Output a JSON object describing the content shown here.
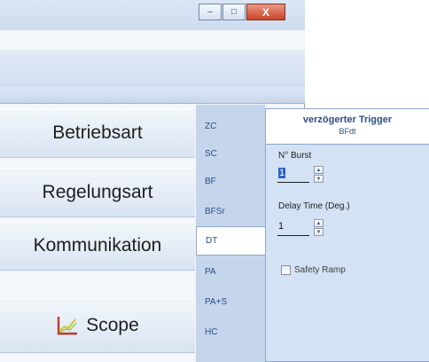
{
  "window": {
    "minimize_symbol": "–",
    "maximize_symbol": "□",
    "close_symbol": "X"
  },
  "nav": {
    "items": [
      {
        "label": "Betriebsart"
      },
      {
        "label": "Regelungsart"
      },
      {
        "label": "Kommunikation"
      },
      {
        "label": "Scope",
        "icon": "scope-chart-icon"
      }
    ]
  },
  "power_tabs": [
    {
      "label": "ZC"
    },
    {
      "label": "SC"
    },
    {
      "label": "BF"
    },
    {
      "label": "BFSr"
    },
    {
      "label": "DT",
      "active": true
    },
    {
      "label": "PA"
    },
    {
      "label": "PA+S"
    },
    {
      "label": "HC"
    }
  ],
  "panel": {
    "title": "verzögerter Trigger",
    "subtitle": "BFdt",
    "burst_label": "N° Burst",
    "burst_value": "1",
    "delay_label": "Delay Time (Deg.)",
    "delay_value": "1",
    "safety_label": "Safety Ramp",
    "safety_checked": false
  },
  "colors": {
    "accent": "#2b4f86",
    "panel_bg": "#d3e2f4",
    "tab_strip": "#c5d6ec",
    "scope_icon_axis": "#c0392b",
    "scope_icon_line": "#c9c62a"
  }
}
